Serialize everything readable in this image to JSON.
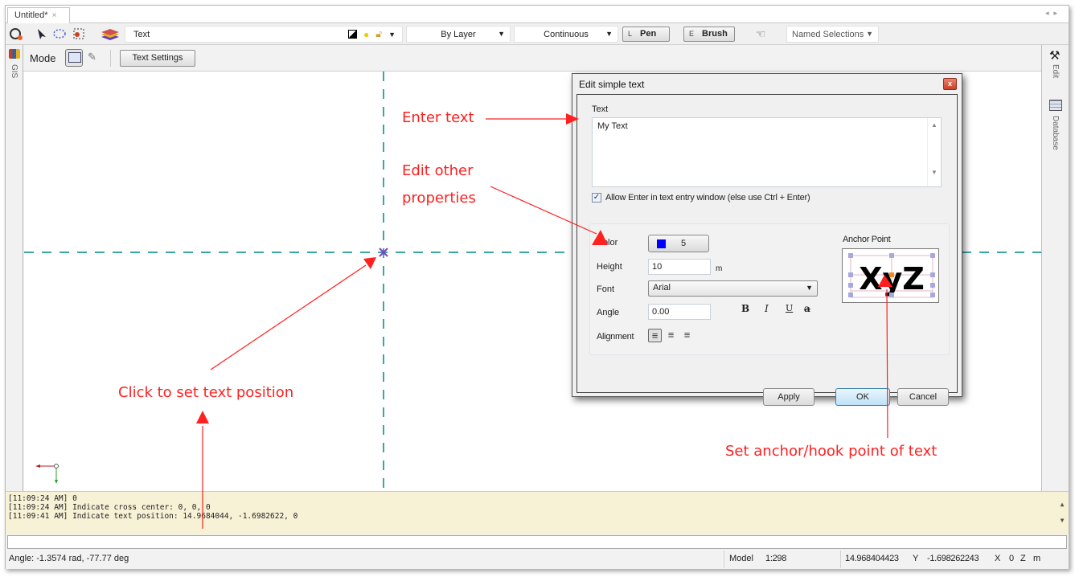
{
  "document_tab": {
    "label": "Untitled*",
    "close": "×"
  },
  "toolbar": {
    "current_layer": "Text",
    "line_color": "By Layer",
    "line_type": "Continuous",
    "pen": {
      "key": "L",
      "label": "Pen"
    },
    "brush": {
      "key": "E",
      "label": "Brush"
    },
    "named_selections": "Named Selections",
    "icons": [
      "snap-icon",
      "select-arrow-icon",
      "lasso-select-icon",
      "select-window-icon",
      "layers-icon",
      "layer-fill-icon",
      "bulb-icon",
      "lock-icon",
      "hand-pointer-icon"
    ]
  },
  "modebar": {
    "mode_label": "Mode",
    "text_settings_button": "Text Settings"
  },
  "left_rail": {
    "tab": "GIS"
  },
  "right_rail": {
    "tabs": [
      "Edit",
      "Database"
    ]
  },
  "dialog": {
    "title": "Edit simple text",
    "close": "x",
    "text_label": "Text",
    "text_value": "My Text",
    "allow_enter_checked": true,
    "allow_enter_label": "Allow Enter in text entry window (else use Ctrl + Enter)",
    "color_label": "Color",
    "color_value": "5",
    "color_swatch": "#0000ff",
    "height_label": "Height",
    "height_value": "10",
    "height_unit": "m",
    "font_label": "Font",
    "font_value": "Arial",
    "angle_label": "Angle",
    "angle_value": "0.00",
    "bold": "B",
    "italic": "I",
    "underline": "U",
    "strike": "a",
    "alignment_label": "Alignment",
    "anchor_label": "Anchor Point",
    "anchor_preview_text": "XyZ",
    "apply_button": "Apply",
    "ok_button": "OK",
    "cancel_button": "Cancel"
  },
  "annotations": {
    "enter_text": "Enter text",
    "edit_other_1": "Edit other",
    "edit_other_2": "properties",
    "click_position": "Click to set text position",
    "set_anchor": "Set anchor/hook point of text",
    "color": "#ff2020"
  },
  "log": {
    "lines": [
      "[11:09:24 AM] 0",
      "[11:09:24 AM] Indicate cross center: 0, 0, 0",
      "[11:09:41 AM] Indicate text position: 14.9684044, -1.6982622, 0"
    ]
  },
  "status": {
    "angle": "Angle: -1.3574 rad, -77.77 deg",
    "space": "Model",
    "scale": "1:298",
    "y_value": "14.968404423",
    "y_label": "Y",
    "x_value": "-1.698262243",
    "x_label": "X",
    "z_value": "0",
    "z_label": "Z",
    "unit": "m"
  }
}
